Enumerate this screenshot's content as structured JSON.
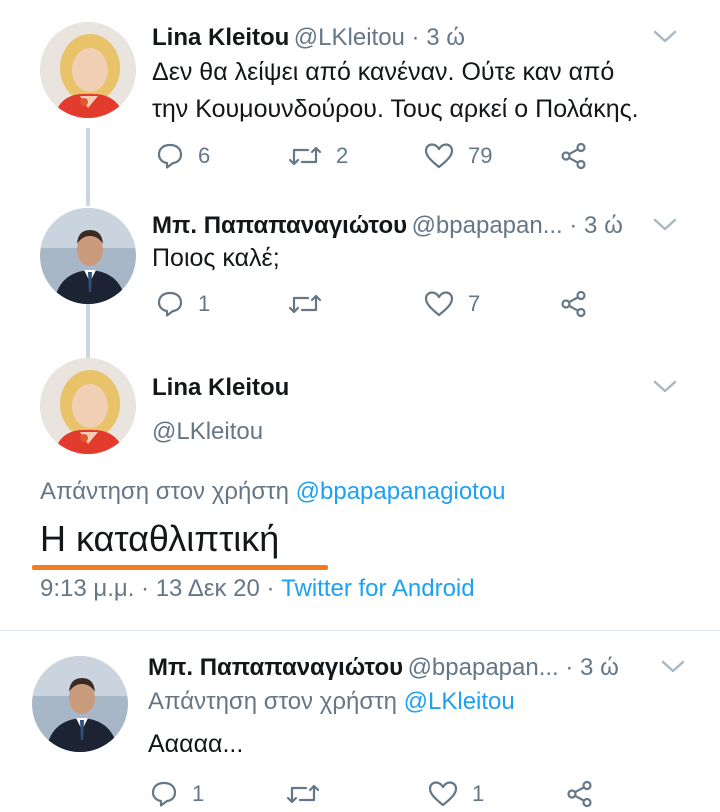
{
  "tweets": [
    {
      "author": "Lina Kleitou",
      "handle": "@LKleitou",
      "time": " · 3 ώ",
      "text_line1": "Δεν θα λείψει από κανέναν.  Ούτε καν από",
      "text_line2": "την Κουμουνδούρου. Τους αρκεί ο Πολάκης.",
      "replies": "6",
      "retweets": "2",
      "likes": "79"
    },
    {
      "author": "Μπ. Παπαπαναγιώτου",
      "handle": "@bpapapan...",
      "time": " · 3 ώ",
      "text": "Ποιος καλέ;",
      "replies": "1",
      "retweets": "",
      "likes": "7"
    }
  ],
  "focused": {
    "author": "Lina Kleitou",
    "handle": "@LKleitou",
    "reply_to_prefix": "Απάντηση στον χρήστη ",
    "reply_to_user": "@bpapapanagiotou",
    "text": "Η καταθλιπτική",
    "timestamp": "9:13 μ.μ. · 13 Δεκ 20 · ",
    "source": "Twitter for Android"
  },
  "reply": {
    "author": "Μπ. Παπαπαναγιώτου",
    "handle": "@bpapapan...",
    "time": " · 3 ώ",
    "reply_to_prefix": "Απάντηση στον χρήστη ",
    "reply_to_user": "@LKleitou",
    "text": "Ααααα...",
    "replies": "1",
    "retweets": "",
    "likes": "1"
  },
  "icons": {
    "reply": "reply-icon",
    "retweet": "retweet-icon",
    "like": "heart-icon",
    "share": "share-icon",
    "more": "chevron-down-icon"
  },
  "colors": {
    "link": "#1da1f2",
    "secondary_text": "#657786",
    "highlight_underline": "#f47b20",
    "thread_line": "#ccd6dd"
  }
}
